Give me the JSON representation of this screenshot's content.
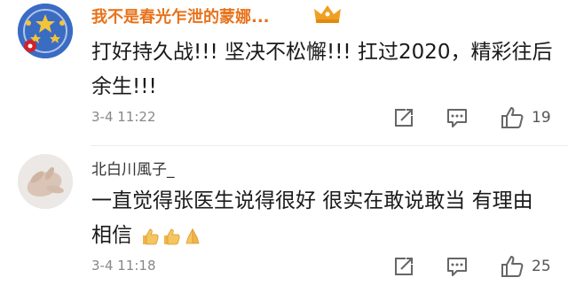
{
  "comments": [
    {
      "username": "我不是春光乍泄的蒙娜...",
      "avatar_icon": "flag-avatar-icon",
      "badge_icon": "crown-badge-icon",
      "text": "打好持久战!!! 坚决不松懈!!! 扛过2020，精彩往后余生!!!",
      "time": "3-4 11:22",
      "likes": "19"
    },
    {
      "username": "北白川風子_",
      "avatar_icon": "hand-photo-avatar-icon",
      "text": "一直觉得张医生说得很好 很实在敢说敢当 有理由相信",
      "emojis": [
        "thumbs-up-icon",
        "thumbs-up-icon",
        "pray-hands-icon"
      ],
      "time": "3-4 11:18",
      "likes": "25"
    }
  ],
  "colors": {
    "username_highlight": "#e8721a",
    "meta_gray": "#888888",
    "icon_gray": "#555555",
    "crown": "#f0a020"
  }
}
